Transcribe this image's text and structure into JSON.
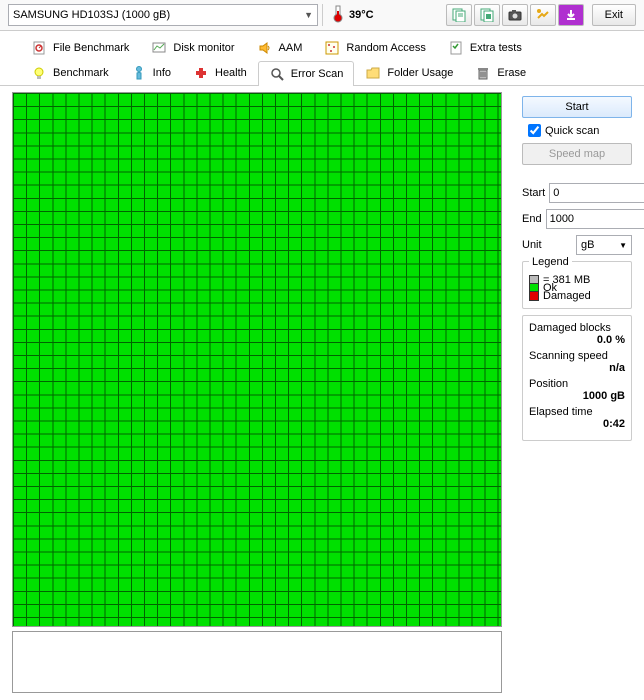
{
  "toolbar": {
    "drive": "SAMSUNG HD103SJ (1000 gB)",
    "temp": "39°C",
    "exit": "Exit"
  },
  "tabs": {
    "file_benchmark": "File Benchmark",
    "disk_monitor": "Disk monitor",
    "aam": "AAM",
    "random_access": "Random Access",
    "extra_tests": "Extra tests",
    "benchmark": "Benchmark",
    "info": "Info",
    "health": "Health",
    "error_scan": "Error Scan",
    "folder_usage": "Folder Usage",
    "erase": "Erase"
  },
  "controls": {
    "start": "Start",
    "quick_scan": "Quick scan",
    "speed_map": "Speed map",
    "start_label": "Start",
    "start_val": "0",
    "end_label": "End",
    "end_val": "1000",
    "unit_label": "Unit",
    "unit_val": "gB"
  },
  "legend": {
    "title": "Legend",
    "block": "= 381 MB",
    "ok": "Ok",
    "damaged": "Damaged"
  },
  "stats": {
    "damaged_label": "Damaged blocks",
    "damaged_val": "0.0 %",
    "speed_label": "Scanning speed",
    "speed_val": "n/a",
    "position_label": "Position",
    "position_val": "1000 gB",
    "elapsed_label": "Elapsed time",
    "elapsed_val": "0:42"
  }
}
